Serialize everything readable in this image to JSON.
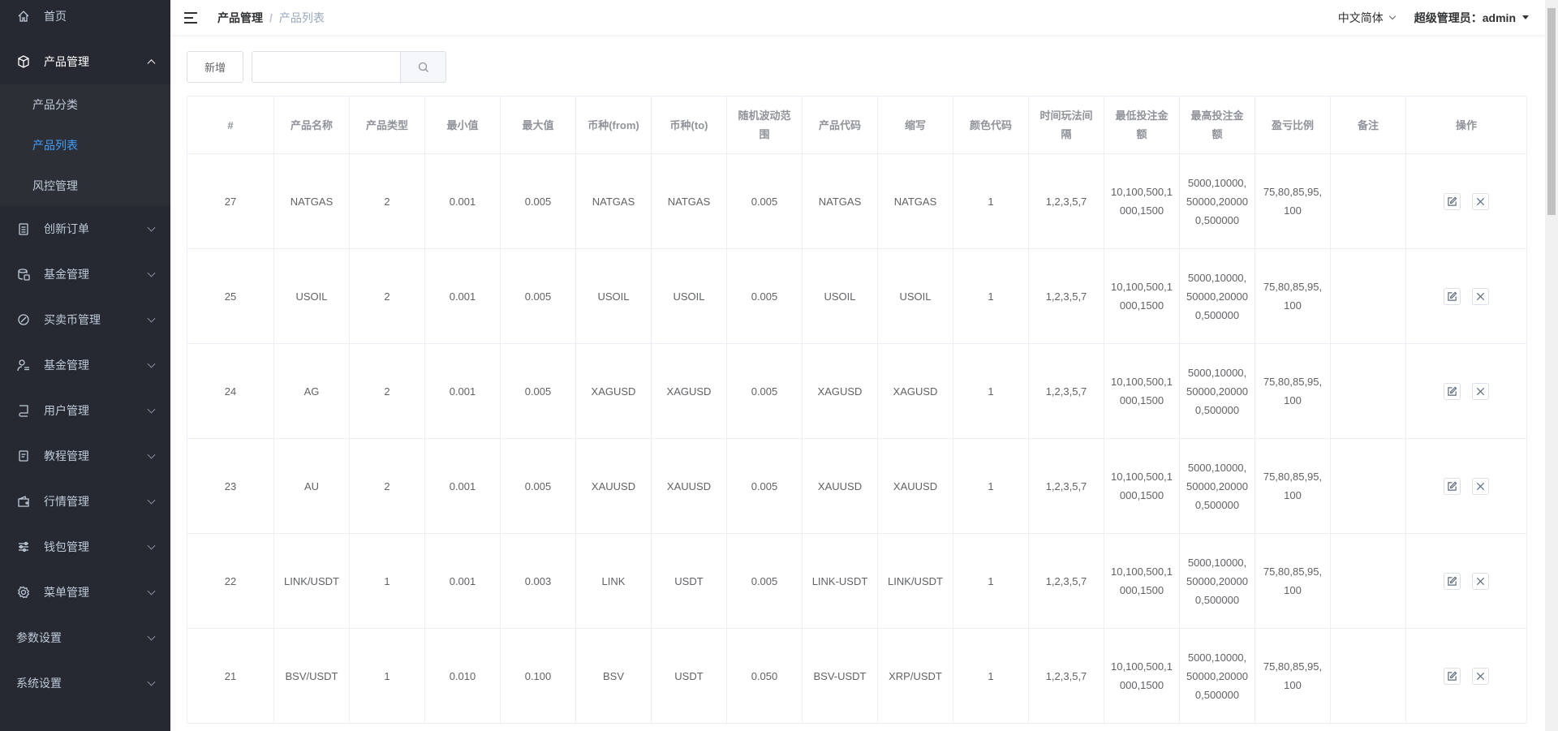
{
  "sidebar": {
    "items": [
      {
        "label": "首页",
        "icon": "home-icon"
      },
      {
        "label": "产品管理",
        "icon": "box-icon",
        "open": true,
        "children": [
          "产品分类",
          "产品列表",
          "风控管理"
        ],
        "active_child": 1
      },
      {
        "label": "创新订单",
        "icon": "clipboard-icon"
      },
      {
        "label": "基金管理",
        "icon": "database-icon"
      },
      {
        "label": "买卖币管理",
        "icon": "coin-icon"
      },
      {
        "label": "基金管理",
        "icon": "user-list-icon"
      },
      {
        "label": "用户管理",
        "icon": "phone-book-icon"
      },
      {
        "label": "教程管理",
        "icon": "document-icon"
      },
      {
        "label": "行情管理",
        "icon": "wallet-icon"
      },
      {
        "label": "钱包管理",
        "icon": "sliders-icon"
      },
      {
        "label": "菜单管理",
        "icon": "gear-icon"
      },
      {
        "label": "参数设置",
        "icon": ""
      },
      {
        "label": "系统设置",
        "icon": ""
      }
    ]
  },
  "header": {
    "breadcrumb": [
      "产品管理",
      "产品列表"
    ],
    "separator": "/",
    "language": "中文简体",
    "user": "超级管理员：admin"
  },
  "toolbar": {
    "add_label": "新增",
    "search_value": "",
    "search_placeholder": ""
  },
  "table": {
    "columns": [
      "#",
      "产品名称",
      "产品类型",
      "最小值",
      "最大值",
      "币种(from)",
      "币种(to)",
      "随机波动范围",
      "产品代码",
      "缩写",
      "颜色代码",
      "时间玩法间隔",
      "最低投注金额",
      "最高投注金额",
      "盈亏比例",
      "备注",
      "操作"
    ],
    "rows": [
      [
        "27",
        "NATGAS",
        "2",
        "0.001",
        "0.005",
        "NATGAS",
        "NATGAS",
        "0.005",
        "NATGAS",
        "NATGAS",
        "1",
        "1,2,3,5,7",
        "10,100,500,1000,1500",
        "5000,10000,50000,200000,500000",
        "75,80,85,95,100",
        ""
      ],
      [
        "25",
        "USOIL",
        "2",
        "0.001",
        "0.005",
        "USOIL",
        "USOIL",
        "0.005",
        "USOIL",
        "USOIL",
        "1",
        "1,2,3,5,7",
        "10,100,500,1000,1500",
        "5000,10000,50000,200000,500000",
        "75,80,85,95,100",
        ""
      ],
      [
        "24",
        "AG",
        "2",
        "0.001",
        "0.005",
        "XAGUSD",
        "XAGUSD",
        "0.005",
        "XAGUSD",
        "XAGUSD",
        "1",
        "1,2,3,5,7",
        "10,100,500,1000,1500",
        "5000,10000,50000,200000,500000",
        "75,80,85,95,100",
        ""
      ],
      [
        "23",
        "AU",
        "2",
        "0.001",
        "0.005",
        "XAUUSD",
        "XAUUSD",
        "0.005",
        "XAUUSD",
        "XAUUSD",
        "1",
        "1,2,3,5,7",
        "10,100,500,1000,1500",
        "5000,10000,50000,200000,500000",
        "75,80,85,95,100",
        ""
      ],
      [
        "22",
        "LINK/USDT",
        "1",
        "0.001",
        "0.003",
        "LINK",
        "USDT",
        "0.005",
        "LINK-USDT",
        "LINK/USDT",
        "1",
        "1,2,3,5,7",
        "10,100,500,1000,1500",
        "5000,10000,50000,200000,500000",
        "75,80,85,95,100",
        ""
      ],
      [
        "21",
        "BSV/USDT",
        "1",
        "0.010",
        "0.100",
        "BSV",
        "USDT",
        "0.050",
        "BSV-USDT",
        "XRP/USDT",
        "1",
        "1,2,3,5,7",
        "10,100,500,1000,1500",
        "5000,10000,50000,200000,500000",
        "75,80,85,95,100",
        ""
      ]
    ]
  },
  "colors": {
    "sidebar_bg": "#262932",
    "active": "#409eff",
    "border": "#ebeef5"
  }
}
